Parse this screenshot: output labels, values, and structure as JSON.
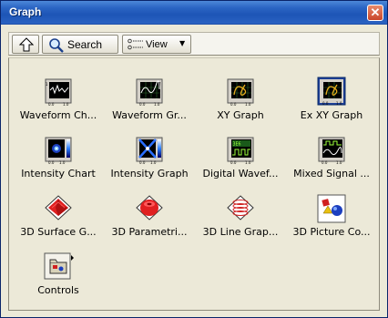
{
  "window": {
    "title": "Graph",
    "close_glyph": "✕"
  },
  "toolbar": {
    "up_icon": "up-arrow-icon",
    "search_label": "Search",
    "view_label": "View"
  },
  "items": [
    {
      "label": "Waveform Ch...",
      "icon": "waveform-chart-icon"
    },
    {
      "label": "Waveform Gr...",
      "icon": "waveform-graph-icon"
    },
    {
      "label": "XY Graph",
      "icon": "xy-graph-icon"
    },
    {
      "label": "Ex XY Graph",
      "icon": "ex-xy-graph-icon"
    },
    {
      "label": "Intensity Chart",
      "icon": "intensity-chart-icon"
    },
    {
      "label": "Intensity Graph",
      "icon": "intensity-graph-icon"
    },
    {
      "label": "Digital Wavef...",
      "icon": "digital-waveform-icon"
    },
    {
      "label": "Mixed Signal ...",
      "icon": "mixed-signal-icon"
    },
    {
      "label": "3D Surface G...",
      "icon": "3d-surface-icon"
    },
    {
      "label": "3D Parametri...",
      "icon": "3d-parametric-icon"
    },
    {
      "label": "3D Line Grap...",
      "icon": "3d-line-graph-icon"
    },
    {
      "label": "3D Picture Co...",
      "icon": "3d-picture-control-icon"
    },
    {
      "label": "Controls",
      "icon": "controls-folder-icon"
    }
  ]
}
